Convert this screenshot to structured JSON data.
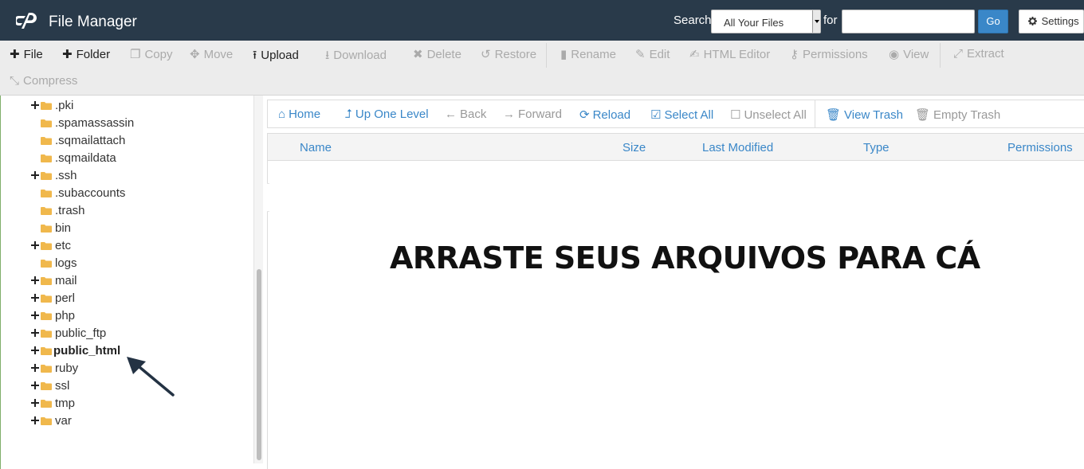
{
  "header": {
    "app_title": "File Manager",
    "search_label": "Search",
    "search_scope": "All Your Files",
    "for_label": "for",
    "search_value": "",
    "go_label": "Go",
    "settings_label": "Settings"
  },
  "toolbar": {
    "file": "File",
    "folder": "Folder",
    "copy": "Copy",
    "move": "Move",
    "upload": "Upload",
    "download": "Download",
    "delete": "Delete",
    "restore": "Restore",
    "rename": "Rename",
    "edit": "Edit",
    "html_editor": "HTML Editor",
    "permissions": "Permissions",
    "view": "View",
    "extract": "Extract",
    "compress": "Compress"
  },
  "tree": {
    "items": [
      {
        "name": ".pki",
        "expandable": true
      },
      {
        "name": ".spamassassin",
        "expandable": false
      },
      {
        "name": ".sqmailattach",
        "expandable": false
      },
      {
        "name": ".sqmaildata",
        "expandable": false
      },
      {
        "name": ".ssh",
        "expandable": true
      },
      {
        "name": ".subaccounts",
        "expandable": false
      },
      {
        "name": ".trash",
        "expandable": false
      },
      {
        "name": "bin",
        "expandable": false
      },
      {
        "name": "etc",
        "expandable": true
      },
      {
        "name": "logs",
        "expandable": false
      },
      {
        "name": "mail",
        "expandable": true
      },
      {
        "name": "perl",
        "expandable": true
      },
      {
        "name": "php",
        "expandable": true
      },
      {
        "name": "public_ftp",
        "expandable": true
      },
      {
        "name": "public_html",
        "expandable": true,
        "highlighted": true
      },
      {
        "name": "ruby",
        "expandable": true
      },
      {
        "name": "ssl",
        "expandable": true
      },
      {
        "name": "tmp",
        "expandable": true
      },
      {
        "name": "var",
        "expandable": true
      }
    ]
  },
  "nav": {
    "home": "Home",
    "up_one_level": "Up One Level",
    "back": "Back",
    "forward": "Forward",
    "reload": "Reload",
    "select_all": "Select All",
    "unselect_all": "Unselect All",
    "view_trash": "View Trash",
    "empty_trash": "Empty Trash"
  },
  "table": {
    "columns": [
      "Name",
      "Size",
      "Last Modified",
      "Type",
      "Permissions"
    ]
  },
  "content": {
    "drop_text": "ARRASTE SEUS ARQUIVOS PARA CÁ"
  },
  "colors": {
    "header_bg": "#293a4a",
    "accent_blue": "#3a87c8",
    "folder": "#f0b84c"
  }
}
